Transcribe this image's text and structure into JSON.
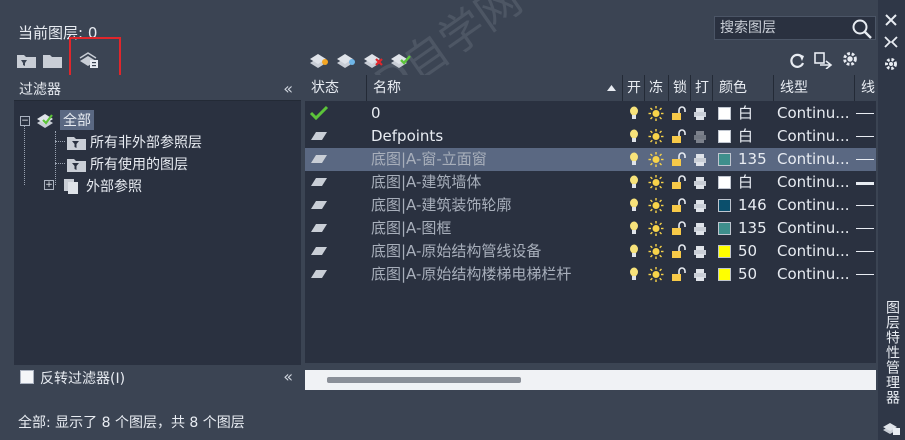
{
  "header": {
    "current_layer": "当前图层: 0",
    "search_placeholder": "搜索图层"
  },
  "palette": {
    "title": "图层特性管理器"
  },
  "filters": {
    "title": "过滤器",
    "root": "全部",
    "children": [
      "所有非外部参照层",
      "所有使用的图层",
      "外部参照"
    ],
    "invert_label": "反转过滤器(I)"
  },
  "table": {
    "columns": [
      "状态",
      "名称",
      "开",
      "冻",
      "锁",
      "打",
      "颜色",
      "线型",
      "线"
    ],
    "rows": [
      {
        "status": "current",
        "name": "0",
        "color_name": "白",
        "color_hex": "#ffffff",
        "linetype": "Continu...",
        "dim": false,
        "selected": false,
        "print_off": false,
        "thick": false
      },
      {
        "status": "layer",
        "name": "Defpoints",
        "color_name": "白",
        "color_hex": "#ffffff",
        "linetype": "Continu...",
        "dim": false,
        "selected": false,
        "print_off": true,
        "thick": false
      },
      {
        "status": "layer",
        "name": "底图|A-窗-立面窗",
        "color_name": "135",
        "color_hex": "#3e8f8c",
        "linetype": "Continu...",
        "dim": true,
        "selected": true,
        "print_off": false,
        "thick": false
      },
      {
        "status": "layer",
        "name": "底图|A-建筑墙体",
        "color_name": "白",
        "color_hex": "#ffffff",
        "linetype": "Continu...",
        "dim": true,
        "selected": false,
        "print_off": false,
        "thick": true
      },
      {
        "status": "layer",
        "name": "底图|A-建筑装饰轮廓",
        "color_name": "146",
        "color_hex": "#0b4f6c",
        "linetype": "Continu...",
        "dim": true,
        "selected": false,
        "print_off": false,
        "thick": false
      },
      {
        "status": "layer",
        "name": "底图|A-图框",
        "color_name": "135",
        "color_hex": "#3e8f8c",
        "linetype": "Continu...",
        "dim": true,
        "selected": false,
        "print_off": false,
        "thick": false
      },
      {
        "status": "layer",
        "name": "底图|A-原始结构管线设备",
        "color_name": "50",
        "color_hex": "#ffff00",
        "linetype": "Continu...",
        "dim": true,
        "selected": false,
        "print_off": false,
        "thick": false
      },
      {
        "status": "layer",
        "name": "底图|A-原始结构楼梯电梯栏杆",
        "color_name": "50",
        "color_hex": "#ffff00",
        "linetype": "Continu...",
        "dim": true,
        "selected": false,
        "print_off": false,
        "thick": false
      }
    ]
  },
  "status_bar": "全部: 显示了 8 个图层，共 8 个图层",
  "watermark": "CAD自学网 www.cadzxw.com",
  "icons": {
    "search": "search-icon",
    "close": "close-icon",
    "autohide": "autohide-icon",
    "settings": "settings-icon",
    "new_property_filter": "new-property-filter-icon",
    "new_group_filter": "new-group-filter-icon",
    "layer_states_manager": "layer-states-manager-icon",
    "new_layer": "new-layer-icon",
    "new_layer_vp_frozen": "new-layer-vp-frozen-icon",
    "delete_layer": "delete-layer-icon",
    "set_current": "set-current-icon",
    "refresh": "refresh-icon"
  }
}
